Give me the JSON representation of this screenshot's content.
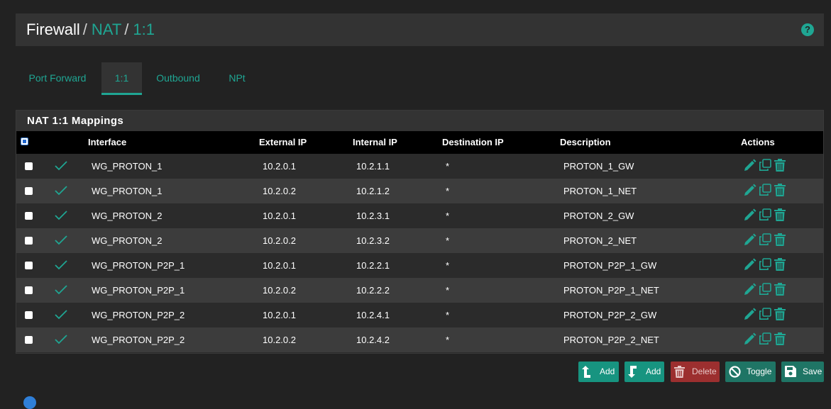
{
  "breadcrumb": {
    "root": "Firewall",
    "sep": "/",
    "level1": "NAT",
    "level2": "1:1"
  },
  "help_icon": "question-circle-icon",
  "tabs": [
    {
      "label": "Port Forward",
      "active": false
    },
    {
      "label": "1:1",
      "active": true
    },
    {
      "label": "Outbound",
      "active": false
    },
    {
      "label": "NPt",
      "active": false
    }
  ],
  "panel": {
    "title": "NAT 1:1 Mappings"
  },
  "table": {
    "columns": {
      "interface": "Interface",
      "external_ip": "External IP",
      "internal_ip": "Internal IP",
      "destination_ip": "Destination IP",
      "description": "Description",
      "actions": "Actions"
    },
    "rows": [
      {
        "interface": "WG_PROTON_1",
        "external_ip": "10.2.0.1",
        "internal_ip": "10.2.1.1",
        "destination_ip": "*",
        "description": "PROTON_1_GW"
      },
      {
        "interface": "WG_PROTON_1",
        "external_ip": "10.2.0.2",
        "internal_ip": "10.2.1.2",
        "destination_ip": "*",
        "description": "PROTON_1_NET"
      },
      {
        "interface": "WG_PROTON_2",
        "external_ip": "10.2.0.1",
        "internal_ip": "10.2.3.1",
        "destination_ip": "*",
        "description": "PROTON_2_GW"
      },
      {
        "interface": "WG_PROTON_2",
        "external_ip": "10.2.0.2",
        "internal_ip": "10.2.3.2",
        "destination_ip": "*",
        "description": "PROTON_2_NET"
      },
      {
        "interface": "WG_PROTON_P2P_1",
        "external_ip": "10.2.0.1",
        "internal_ip": "10.2.2.1",
        "destination_ip": "*",
        "description": "PROTON_P2P_1_GW"
      },
      {
        "interface": "WG_PROTON_P2P_1",
        "external_ip": "10.2.0.2",
        "internal_ip": "10.2.2.2",
        "destination_ip": "*",
        "description": "PROTON_P2P_1_NET"
      },
      {
        "interface": "WG_PROTON_P2P_2",
        "external_ip": "10.2.0.1",
        "internal_ip": "10.2.4.1",
        "destination_ip": "*",
        "description": "PROTON_P2P_2_GW"
      },
      {
        "interface": "WG_PROTON_P2P_2",
        "external_ip": "10.2.0.2",
        "internal_ip": "10.2.4.2",
        "destination_ip": "*",
        "description": "PROTON_P2P_2_NET"
      }
    ],
    "row_icons": [
      "enabled-check-icon",
      "edit-pencil-icon",
      "copy-icon",
      "delete-trash-icon"
    ]
  },
  "buttons": {
    "add_top": "Add",
    "add_bottom": "Add",
    "delete": "Delete",
    "toggle": "Toggle",
    "save": "Save"
  },
  "colors": {
    "accent": "#1fa693",
    "background": "#222222",
    "panel": "#333333",
    "danger": "#9c2f2f"
  }
}
